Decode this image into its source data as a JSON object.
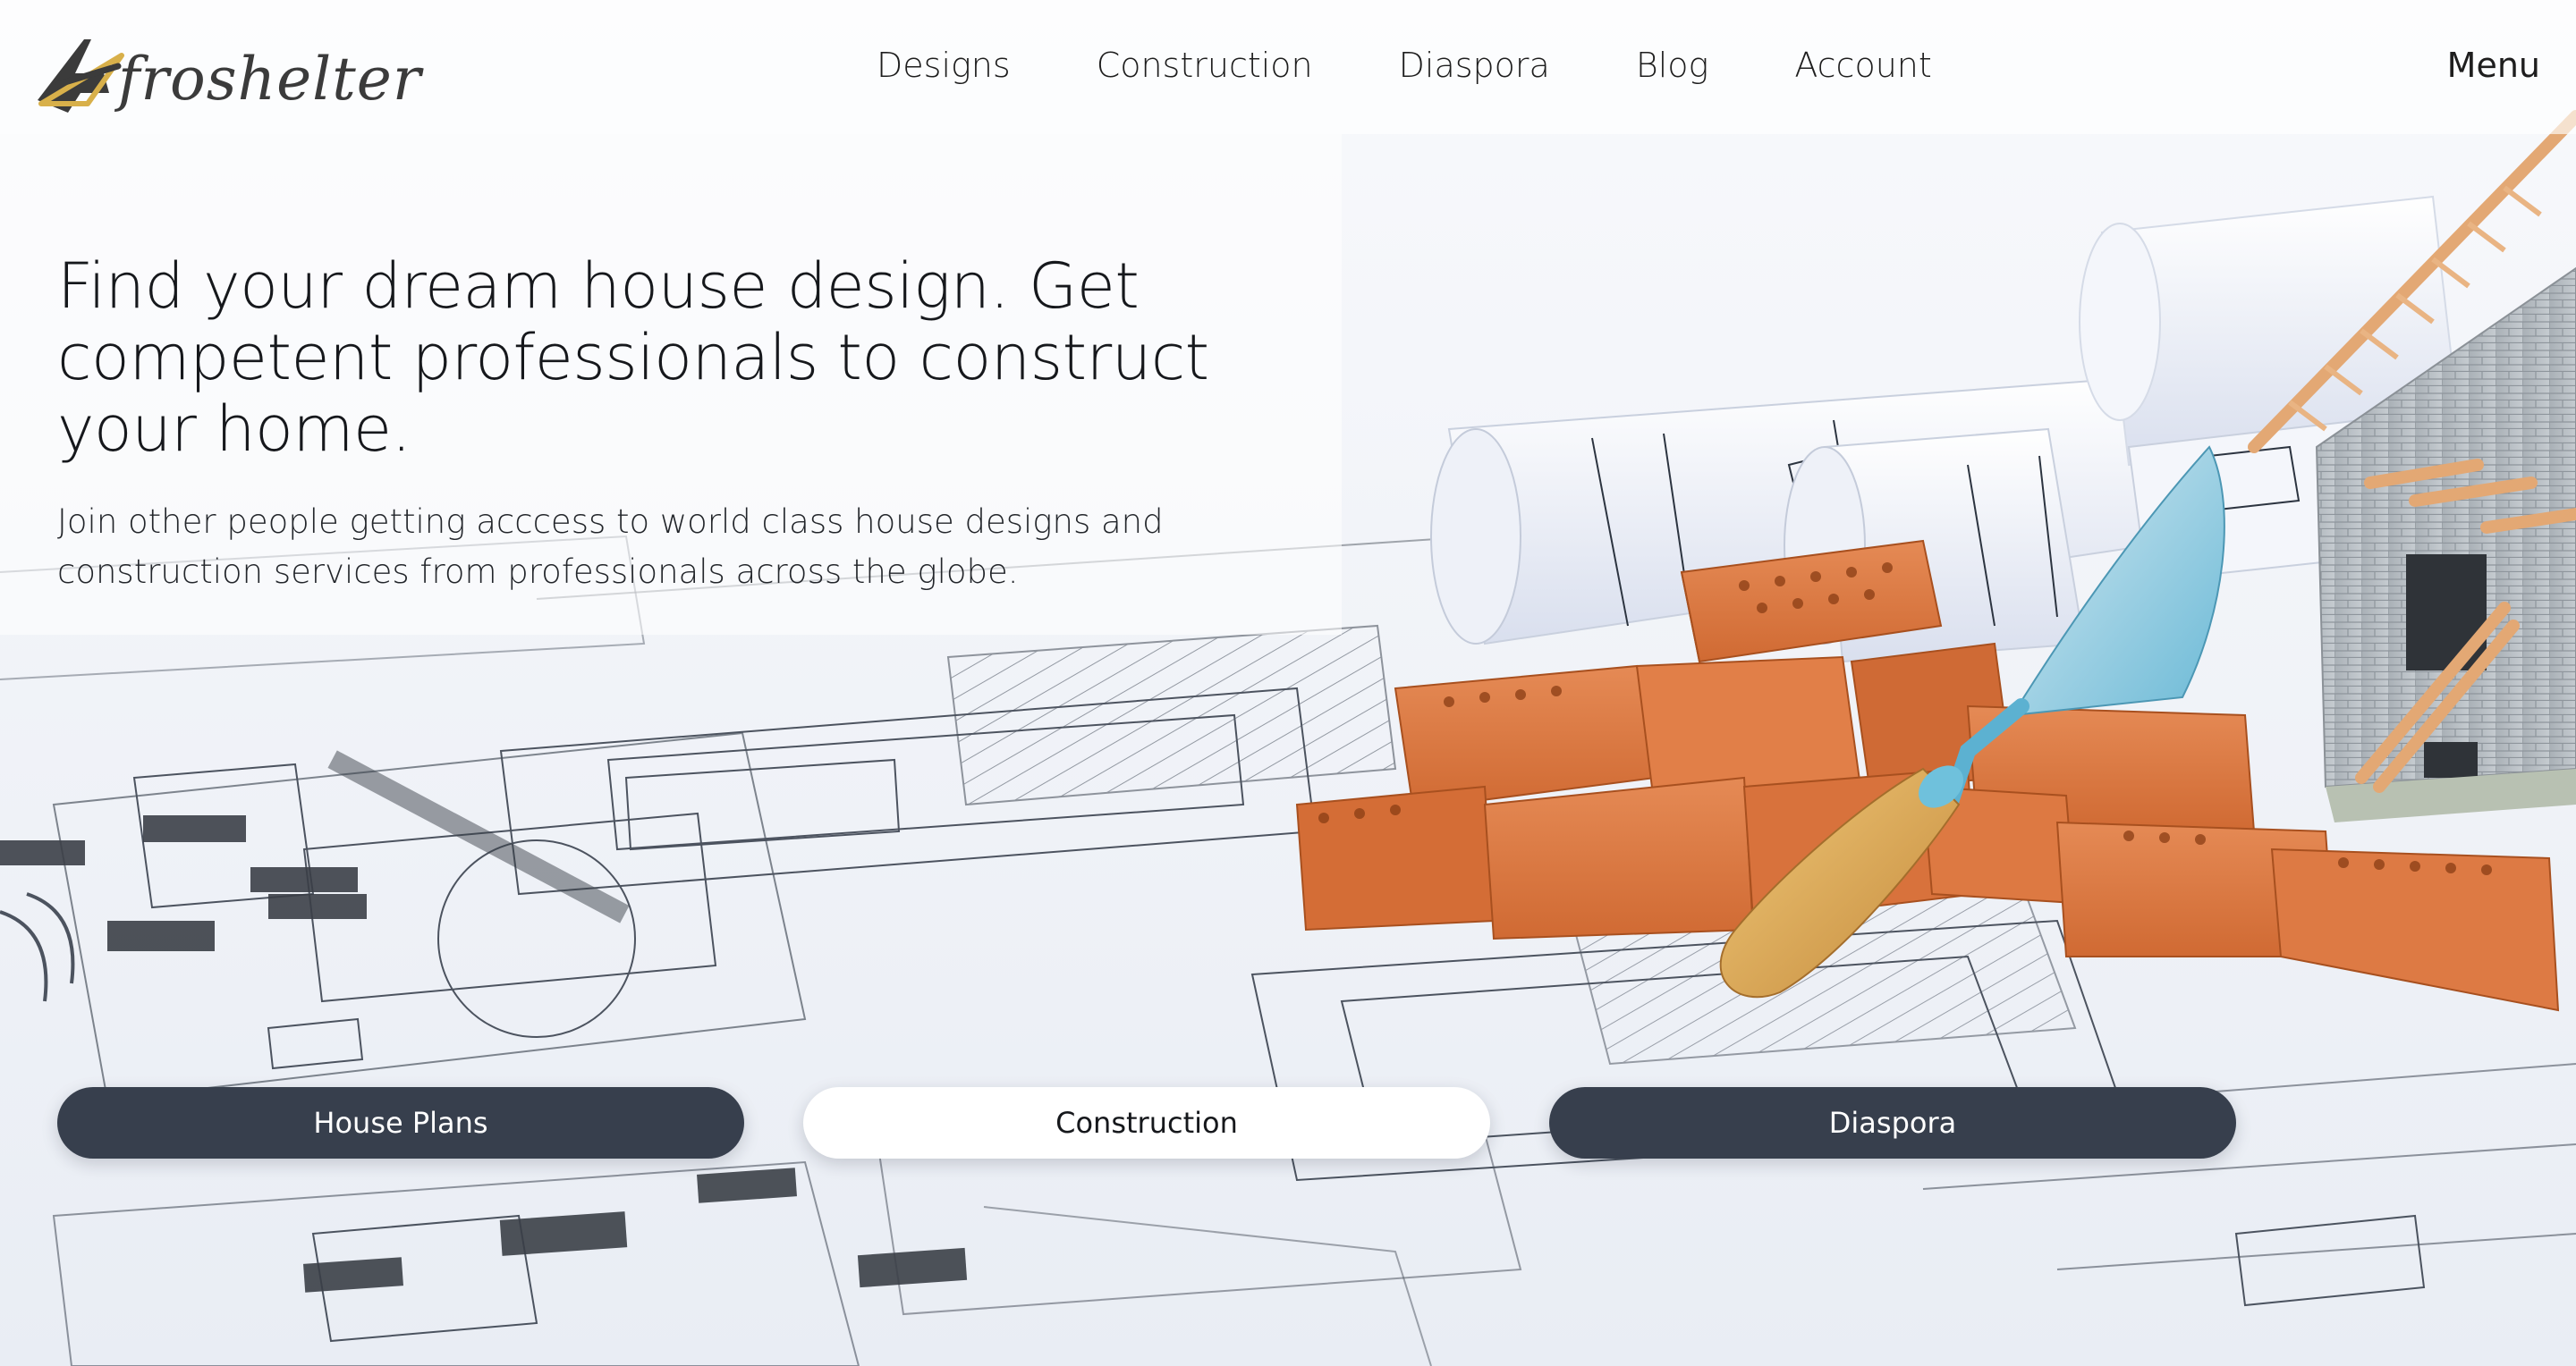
{
  "brand": {
    "name": "froshelter",
    "accent": "#d8b04a",
    "dark": "#3b3b3b"
  },
  "nav": {
    "items": [
      {
        "label": "Designs"
      },
      {
        "label": "Construction"
      },
      {
        "label": "Diaspora"
      },
      {
        "label": "Blog"
      },
      {
        "label": "Account"
      }
    ],
    "menu_label": "Menu"
  },
  "hero": {
    "title": "Find your dream house design. Get competent professionals to construct your home.",
    "subtitle": "Join other people getting acccess to world class house designs and construction services from professionals across the globe."
  },
  "cta": [
    {
      "label": "House Plans",
      "style": "dark"
    },
    {
      "label": "Construction",
      "style": "light"
    },
    {
      "label": "Diaspora",
      "style": "dark"
    }
  ],
  "colors": {
    "button_dark": "#373f4d",
    "brick": "#d9743f",
    "blueprint_line": "#2c3440"
  }
}
